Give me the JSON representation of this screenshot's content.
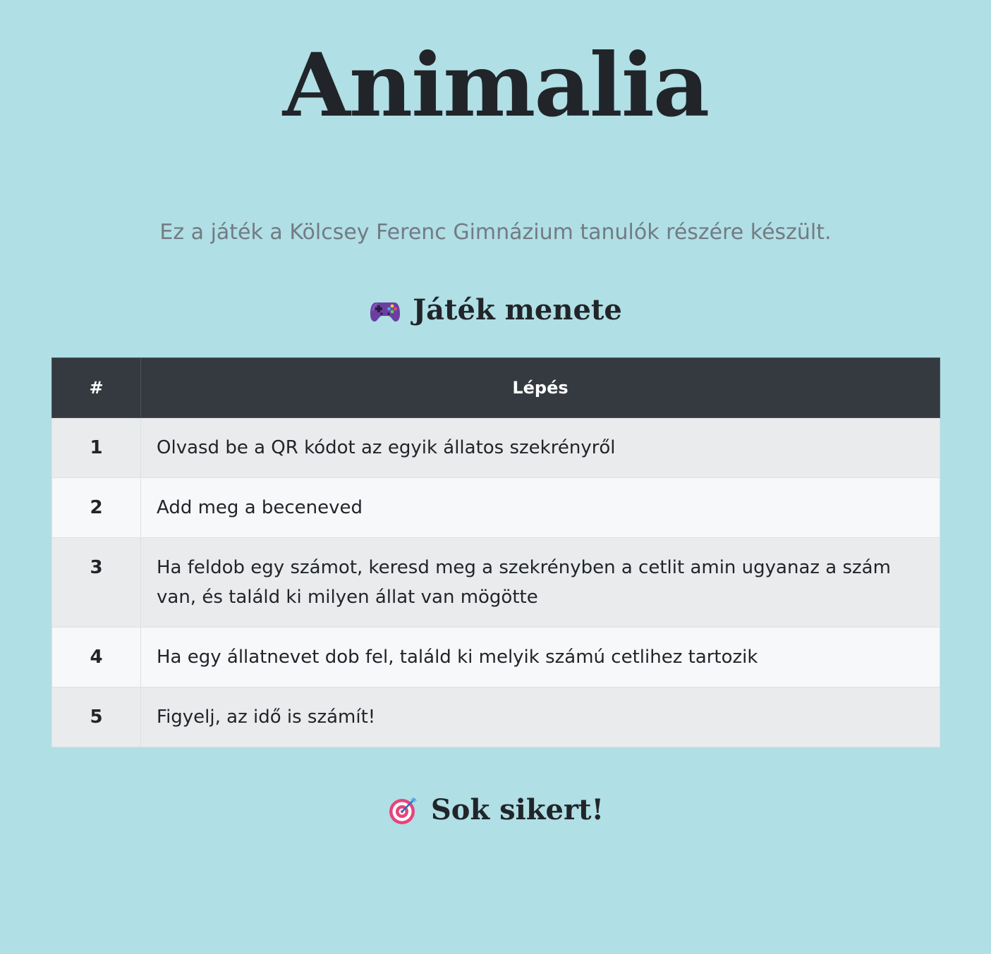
{
  "header": {
    "title": "Animalia",
    "lead": "Ez a játék a Kölcsey Ferenc Gimnázium tanulók részére készült."
  },
  "steps_section": {
    "heading": "Játék menete",
    "icon": "game-controller-icon",
    "table": {
      "columns": [
        "#",
        "Lépés"
      ],
      "rows": [
        {
          "num": "1",
          "text": "Olvasd be a QR kódot az egyik állatos szekrényről"
        },
        {
          "num": "2",
          "text": "Add meg a beceneved"
        },
        {
          "num": "3",
          "text": "Ha feldob egy számot, keresd meg a szekrényben a cetlit amin ugyanaz a szám van, és találd ki milyen állat van mögötte"
        },
        {
          "num": "4",
          "text": "Ha egy állatnevet dob fel, találd ki melyik számú cetlihez tartozik"
        },
        {
          "num": "5",
          "text": "Figyelj, az idő is számít!"
        }
      ]
    }
  },
  "footer_section": {
    "heading": "Sok sikert!",
    "icon": "bullseye-dart-icon"
  },
  "colors": {
    "background": "#b0dfe5",
    "table_header": "#343a40",
    "row_odd": "#eaebed",
    "row_even": "#f7f8fa",
    "lead_text": "#727b83"
  }
}
